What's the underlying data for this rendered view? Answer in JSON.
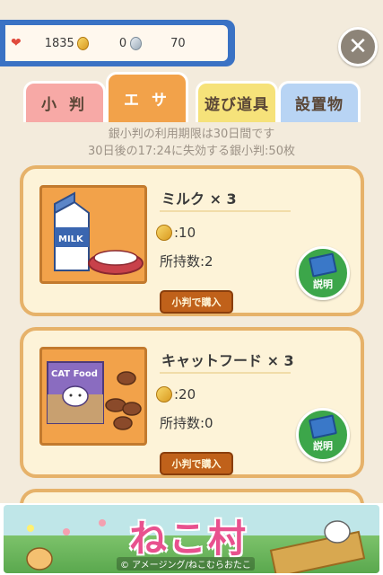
{
  "status": {
    "hearts": "1835",
    "gold_count": "0",
    "silver_count": "70"
  },
  "tabs": [
    {
      "label": "小 判"
    },
    {
      "label": "エ サ"
    },
    {
      "label": "遊び道具"
    },
    {
      "label": "設置物"
    }
  ],
  "notice": {
    "line1": "銀小判の利用期限は30日間です",
    "line2": "30日後の17:24に失効する銀小判:50枚"
  },
  "items": [
    {
      "name": "ミルク × 3",
      "price": ":10",
      "owned": "所持数:2",
      "buy_label": "小判で購入",
      "info_label": "説明",
      "image_text": "MILK"
    },
    {
      "name": "キャットフード × 3",
      "price": ":20",
      "owned": "所持数:0",
      "buy_label": "小判で購入",
      "info_label": "説明",
      "image_text": "CAT Food"
    }
  ],
  "banner": {
    "title": "ねこ村",
    "subtitle": "© アメージング/ねこむらおたこ"
  },
  "colors": {
    "accent": "#f2a24a",
    "status_border": "#3a72c4",
    "buy_button": "#c0611a",
    "info_button": "#3ca64a"
  }
}
